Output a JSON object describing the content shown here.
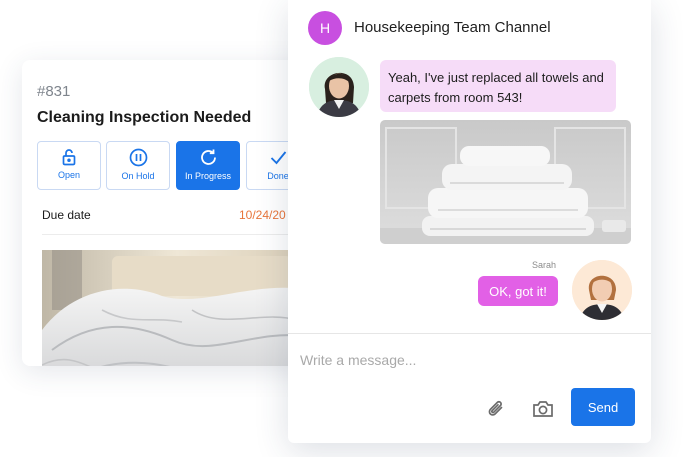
{
  "task": {
    "id": "#831",
    "title": "Cleaning Inspection Needed",
    "statuses": [
      {
        "label": "Open",
        "icon": "unlock-icon",
        "active": false
      },
      {
        "label": "On Hold",
        "icon": "pause-icon",
        "active": false
      },
      {
        "label": "In Progress",
        "icon": "refresh-icon",
        "active": true
      },
      {
        "label": "Done",
        "icon": "check-icon",
        "active": false
      }
    ],
    "due_label": "Due date",
    "due_value": "10/24/20"
  },
  "chat": {
    "avatar_letter": "H",
    "title": "Housekeeping Team Channel",
    "incoming_message": "Yeah, I've just replaced all towels and carpets from room 543!",
    "sender_name": "Sarah",
    "outgoing_message": "OK, got it!",
    "input_placeholder": "Write a message...",
    "send_label": "Send"
  },
  "colors": {
    "accent": "#1a74e8",
    "channel_avatar": "#c84fe0",
    "incoming_bubble": "#f6dcf8",
    "outgoing_bubble": "#e260e6",
    "due_date": "#e8753a"
  }
}
